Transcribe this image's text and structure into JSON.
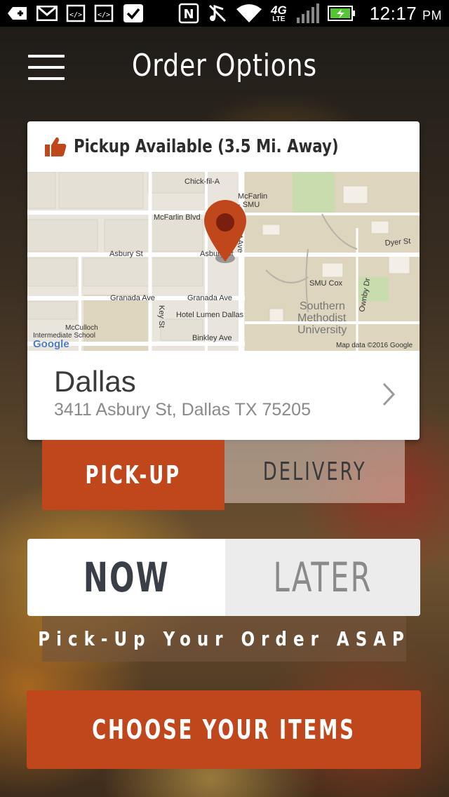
{
  "status_bar": {
    "network": "4G",
    "network_sub": "LTE",
    "time": "12:17",
    "time_suffix": "PM",
    "icons": [
      "add-icon",
      "gmail-icon",
      "code-icon",
      "code-icon",
      "check-icon",
      "nfc-icon",
      "mute-icon",
      "wifi-icon",
      "signal-icon",
      "battery-charging-icon"
    ]
  },
  "header": {
    "title": "Order Options",
    "menu_icon": "hamburger-menu-icon"
  },
  "location": {
    "availability": "Pickup Available (3.5 Mi. Away)",
    "city": "Dallas",
    "address": "3411 Asbury St, Dallas TX 75205"
  },
  "map": {
    "labels": {
      "chick_fil_a": "Chick-fil-A",
      "mcfarlin_smu": "McFarlin",
      "mcfarlin_smu2": "- SMU",
      "mcfarlin_blvd": "McFarlin Blvd",
      "asbury_left": "Asbury St",
      "asbury_right": "Asbury St",
      "hillcrest": "Hillcrest Ave",
      "dyer": "Dyer St",
      "smu_cox": "SMU Cox",
      "ownby": "Ownby Dr",
      "southern": "Southern",
      "methodist": "Methodist",
      "university": "University",
      "granada_left": "Granada Ave",
      "granada_right": "Granada Ave",
      "key_st": "Key St",
      "hotel": "Hotel Lumen Dallas",
      "mcculloch1": "McCulloch",
      "mcculloch2": "Intermediate School",
      "binkley": "Binkley Ave",
      "google": "Google",
      "map_data": "Map data ©2016 Google"
    },
    "colors": {
      "land": "#e9e5dc",
      "campus": "#ddd5bd",
      "road": "#ffffff",
      "pin": "#c0461b"
    }
  },
  "order_method": {
    "pickup": "PICK-UP",
    "delivery": "DELIVERY",
    "selected": "pickup"
  },
  "order_time": {
    "now": "NOW",
    "later": "LATER",
    "selected": "now",
    "note": "Pick-Up Your Order ASAP"
  },
  "cta": {
    "label": "CHOOSE YOUR ITEMS"
  },
  "colors": {
    "accent": "#c0461b",
    "text_dark": "#3a3f47",
    "text_muted": "#8a8a8a"
  }
}
